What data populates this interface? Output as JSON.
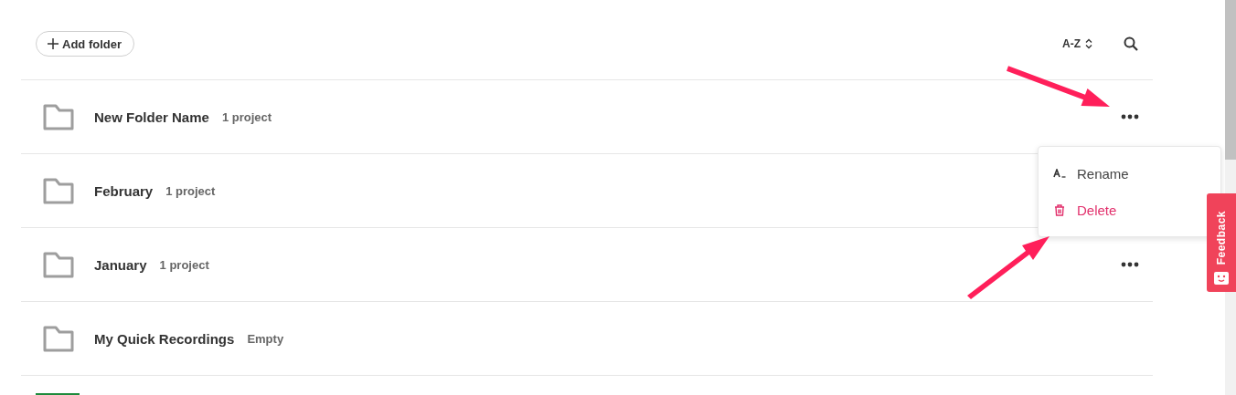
{
  "toolbar": {
    "add_button": {
      "label": "Add folder"
    },
    "sort": {
      "label": "A-Z"
    }
  },
  "folders": [
    {
      "kind": "folder",
      "name": "New Folder Name",
      "count": "1 project",
      "more_button": true
    },
    {
      "kind": "folder",
      "name": "February",
      "count": "1 project",
      "more_button": false
    },
    {
      "kind": "folder",
      "name": "January",
      "count": "1 project",
      "more_button": true
    },
    {
      "kind": "folder",
      "name": "My Quick Recordings",
      "count": "Empty",
      "more_button": false
    },
    {
      "kind": "project"
    }
  ],
  "context_menu": {
    "items": [
      {
        "kind": "rename",
        "label": "Rename"
      },
      {
        "kind": "delete",
        "label": "Delete"
      }
    ]
  },
  "feedback_tab": {
    "label": "Feedback"
  }
}
